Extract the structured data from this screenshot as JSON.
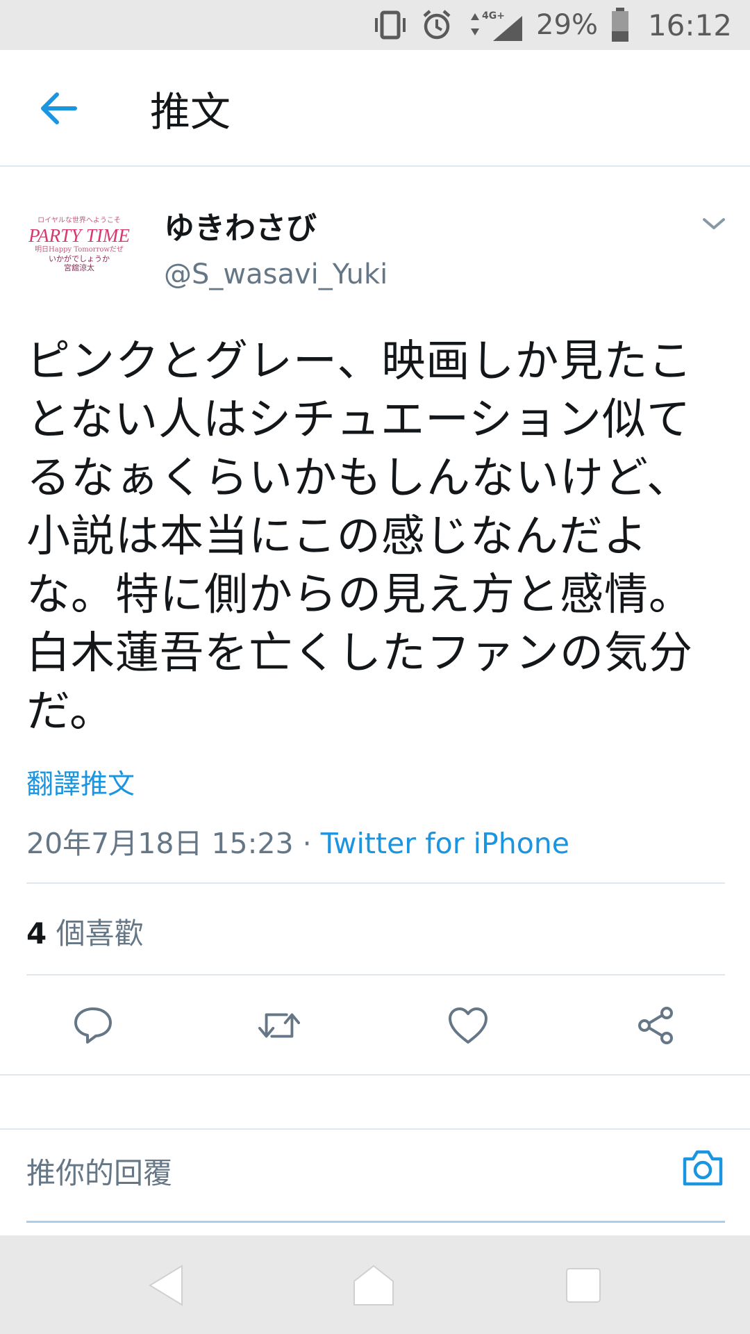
{
  "status_bar": {
    "battery_percent": "29%",
    "time": "16:12",
    "network": "4G+"
  },
  "header": {
    "title": "推文"
  },
  "tweet": {
    "display_name": "ゆきわさび",
    "handle": "@S_wasavi_Yuki",
    "text": "ピンクとグレー、映画しか見たことない人はシチュエーション似てるなぁくらいかもしんないけど、小説は本当にこの感じなんだよな。特に側からの見え方と感情。白木蓮吾を亡くしたファンの気分だ。",
    "translate_label": "翻譯推文",
    "timestamp": "20年7月18日 15:23",
    "separator": " · ",
    "source": "Twitter for iPhone",
    "like_count": "4",
    "like_label": " 個喜歡",
    "avatar_text": {
      "line1": "ロイヤルな世界へようこそ",
      "line2": "PARTY TIME",
      "line3": "明日Happy Tomorrowだぜ",
      "line4": "いかがでしょうか",
      "line5": "宮舘涼太"
    }
  },
  "reply": {
    "placeholder": "推你的回覆"
  },
  "colors": {
    "accent": "#1b95e0",
    "secondary_text": "#657786",
    "divider": "#e1e8ed"
  },
  "icons": [
    "back-arrow-icon",
    "caret-down-icon",
    "reply-icon",
    "retweet-icon",
    "like-icon",
    "share-icon",
    "camera-icon",
    "nav-back-icon",
    "nav-home-icon",
    "nav-recents-icon"
  ]
}
